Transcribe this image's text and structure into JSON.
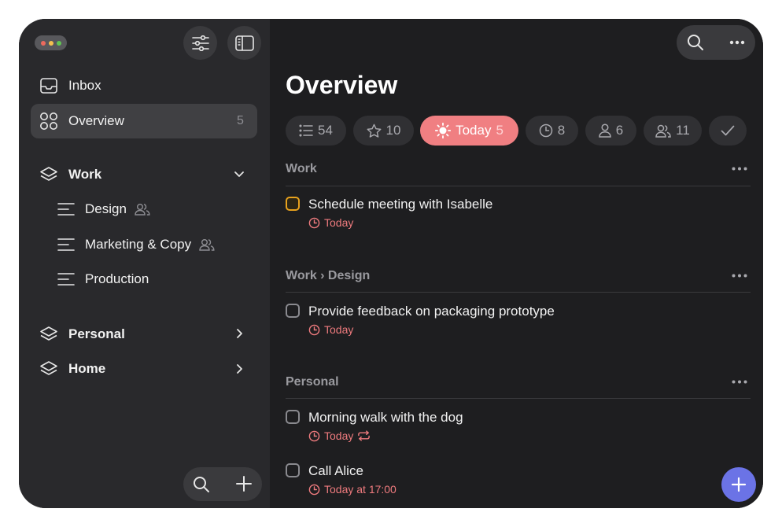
{
  "sidebar": {
    "inbox": "Inbox",
    "overview": {
      "label": "Overview",
      "count": "5"
    },
    "groups": [
      {
        "label": "Work",
        "expanded": true,
        "items": [
          {
            "label": "Design",
            "shared": true
          },
          {
            "label": "Marketing & Copy",
            "shared": true
          },
          {
            "label": "Production",
            "shared": false
          }
        ]
      },
      {
        "label": "Personal",
        "expanded": false
      },
      {
        "label": "Home",
        "expanded": false
      }
    ],
    "icons": [
      "filter-icon",
      "sidebar-toggle-icon",
      "search-icon",
      "plus-icon"
    ]
  },
  "main": {
    "title": "Overview",
    "chips": [
      {
        "name": "all",
        "icon": "list-icon",
        "count": "54"
      },
      {
        "name": "starred",
        "icon": "star-icon",
        "count": "10"
      },
      {
        "name": "today",
        "label": "Today",
        "icon": "sun-icon",
        "count": "5"
      },
      {
        "name": "scheduled",
        "icon": "clock-icon",
        "count": "8"
      },
      {
        "name": "assigned",
        "icon": "person-icon",
        "count": "6"
      },
      {
        "name": "shared",
        "icon": "people-icon",
        "count": "11"
      },
      {
        "name": "completed",
        "icon": "check-icon"
      }
    ],
    "sections": [
      {
        "title": "Work",
        "tasks": [
          {
            "title": "Schedule meeting with Isabelle",
            "due": "Today",
            "active": true
          }
        ]
      },
      {
        "title": "Work › Design",
        "tasks": [
          {
            "title": "Provide feedback on packaging prototype",
            "due": "Today"
          }
        ]
      },
      {
        "title": "Personal",
        "tasks": [
          {
            "title": "Morning walk with the dog",
            "due": "Today",
            "repeat": true
          },
          {
            "title": "Call Alice",
            "due": "Today at 17:00"
          }
        ]
      }
    ],
    "more_label": "•••"
  },
  "colors": {
    "accent_today": "#f07f82",
    "fab": "#6b73e6",
    "active_checkbox": "#e8a21d"
  }
}
